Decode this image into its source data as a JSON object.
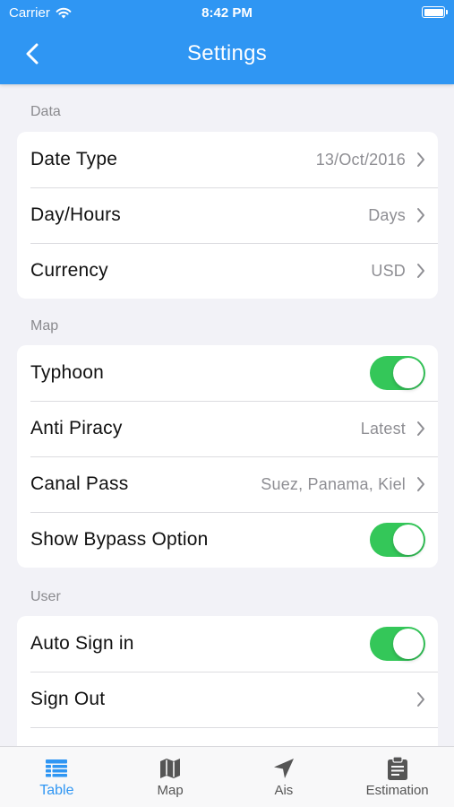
{
  "status_bar": {
    "carrier": "Carrier",
    "time": "8:42 PM"
  },
  "nav": {
    "title": "Settings",
    "back_icon": "chevron-left-icon"
  },
  "sections": {
    "data": {
      "header": "Data",
      "rows": [
        {
          "label": "Date Type",
          "value": "13/Oct/2016"
        },
        {
          "label": "Day/Hours",
          "value": "Days"
        },
        {
          "label": "Currency",
          "value": "USD"
        }
      ]
    },
    "map": {
      "header": "Map",
      "rows": [
        {
          "label": "Typhoon",
          "toggle": true
        },
        {
          "label": "Anti Piracy",
          "value": "Latest"
        },
        {
          "label": "Canal Pass",
          "value": "Suez, Panama, Kiel"
        },
        {
          "label": "Show Bypass Option",
          "toggle": true
        }
      ]
    },
    "user": {
      "header": "User",
      "rows": [
        {
          "label": "Auto Sign in",
          "toggle": true
        },
        {
          "label": "Sign Out",
          "value": ""
        }
      ]
    }
  },
  "tabs": [
    {
      "label": "Table",
      "icon": "list-icon",
      "active": true
    },
    {
      "label": "Map",
      "icon": "map-icon",
      "active": false
    },
    {
      "label": "Ais",
      "icon": "location-arrow-icon",
      "active": false
    },
    {
      "label": "Estimation",
      "icon": "clipboard-icon",
      "active": false
    }
  ],
  "colors": {
    "accent": "#2f96f3",
    "toggle_on": "#34c759",
    "background": "#f2f2f7"
  }
}
